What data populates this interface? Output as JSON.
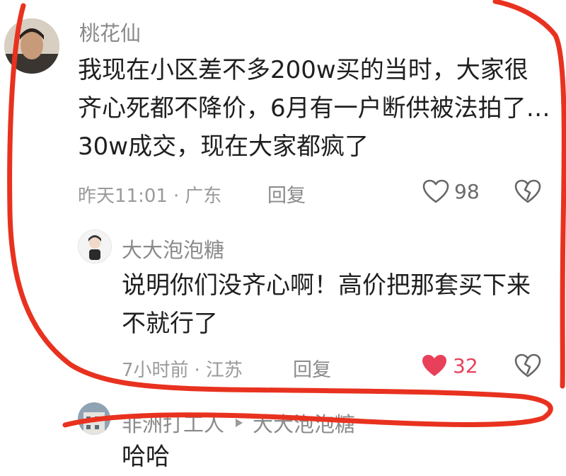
{
  "comments": [
    {
      "username": "桃花仙",
      "lines": [
        "我现在小区差不多200w买的当时，大家很",
        "齐心死都不降价，6月有一户断供被法拍了…",
        "30w成交，现在大家都疯了"
      ],
      "time": "昨天11:01",
      "location": "广东",
      "reply_label": "回复",
      "likes": "98",
      "liked": false
    },
    {
      "username": "大大泡泡糖",
      "lines": [
        "说明你们没齐心啊！高价把那套买下来",
        "不就行了"
      ],
      "time": "7小时前",
      "location": "江苏",
      "reply_label": "回复",
      "likes": "32",
      "liked": true
    },
    {
      "username": "非洲打工人",
      "reply_to": "大大泡泡糖",
      "lines": [
        "哈哈"
      ]
    }
  ],
  "meta_separator": "·",
  "colors": {
    "annotation_circle": "#e8321f",
    "like_active": "#e8405a",
    "username": "#8a8a8a",
    "text": "#1f1f1f"
  }
}
